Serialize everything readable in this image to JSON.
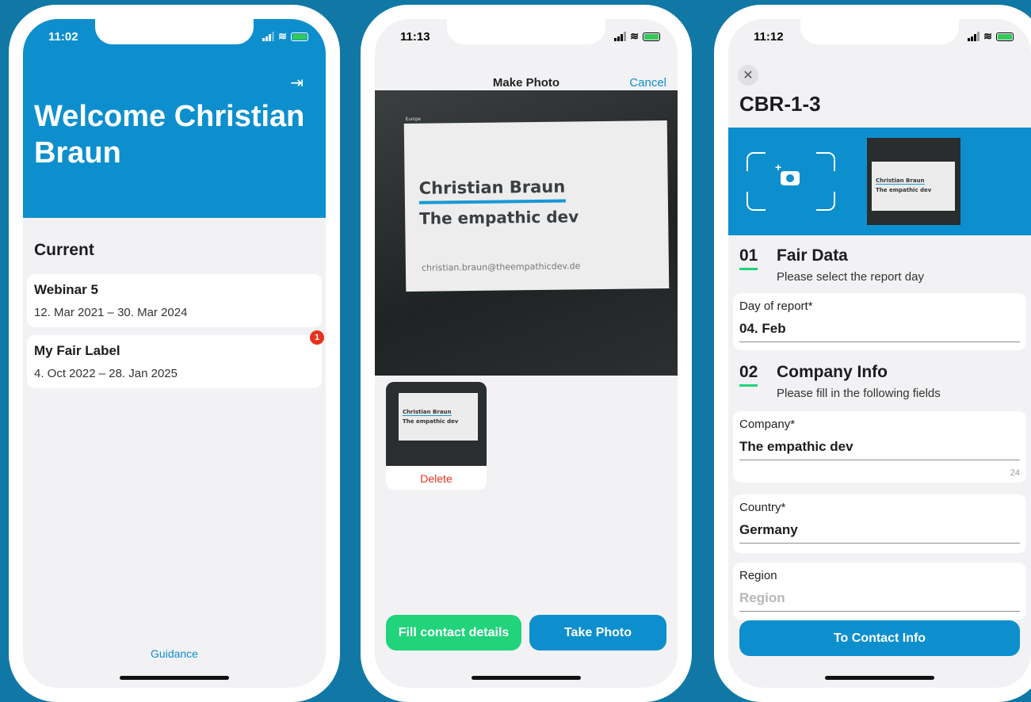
{
  "screen1": {
    "time": "11:02",
    "welcome_title": "Welcome Christian Braun",
    "section_title": "Current",
    "events": [
      {
        "name": "Webinar 5",
        "dates": "12. Mar 2021 – 30. Mar 2024",
        "badge": ""
      },
      {
        "name": "My Fair Label",
        "dates": "4. Oct 2022 – 28. Jan 2025",
        "badge": "1"
      }
    ],
    "guidance_label": "Guidance"
  },
  "screen2": {
    "time": "11:13",
    "nav_title": "Make Photo",
    "cancel_label": "Cancel",
    "card_small_text": "Europe",
    "card_name": "Christian Braun",
    "card_subtitle": "The empathic dev",
    "card_email": "christian.braun@theempathicdev.de",
    "delete_label": "Delete",
    "fill_button": "Fill contact details",
    "take_button": "Take Photo"
  },
  "screen3": {
    "time": "11:12",
    "title": "CBR-1-3",
    "steps": [
      {
        "num": "01",
        "title": "Fair Data",
        "subtitle": "Please select the report day"
      },
      {
        "num": "02",
        "title": "Company Info",
        "subtitle": "Please fill in the following fields"
      }
    ],
    "fields": {
      "day_label": "Day of report*",
      "day_value": "04. Feb",
      "company_label": "Company*",
      "company_value": "The empathic dev",
      "company_counter": "24",
      "country_label": "Country*",
      "country_value": "Germany",
      "region_label": "Region",
      "region_placeholder": "Region"
    },
    "submit_button": "To Contact Info"
  },
  "colors": {
    "accent": "#0d8fce",
    "green": "#21d37a",
    "danger": "#e8321f",
    "background": "#1178a6"
  }
}
